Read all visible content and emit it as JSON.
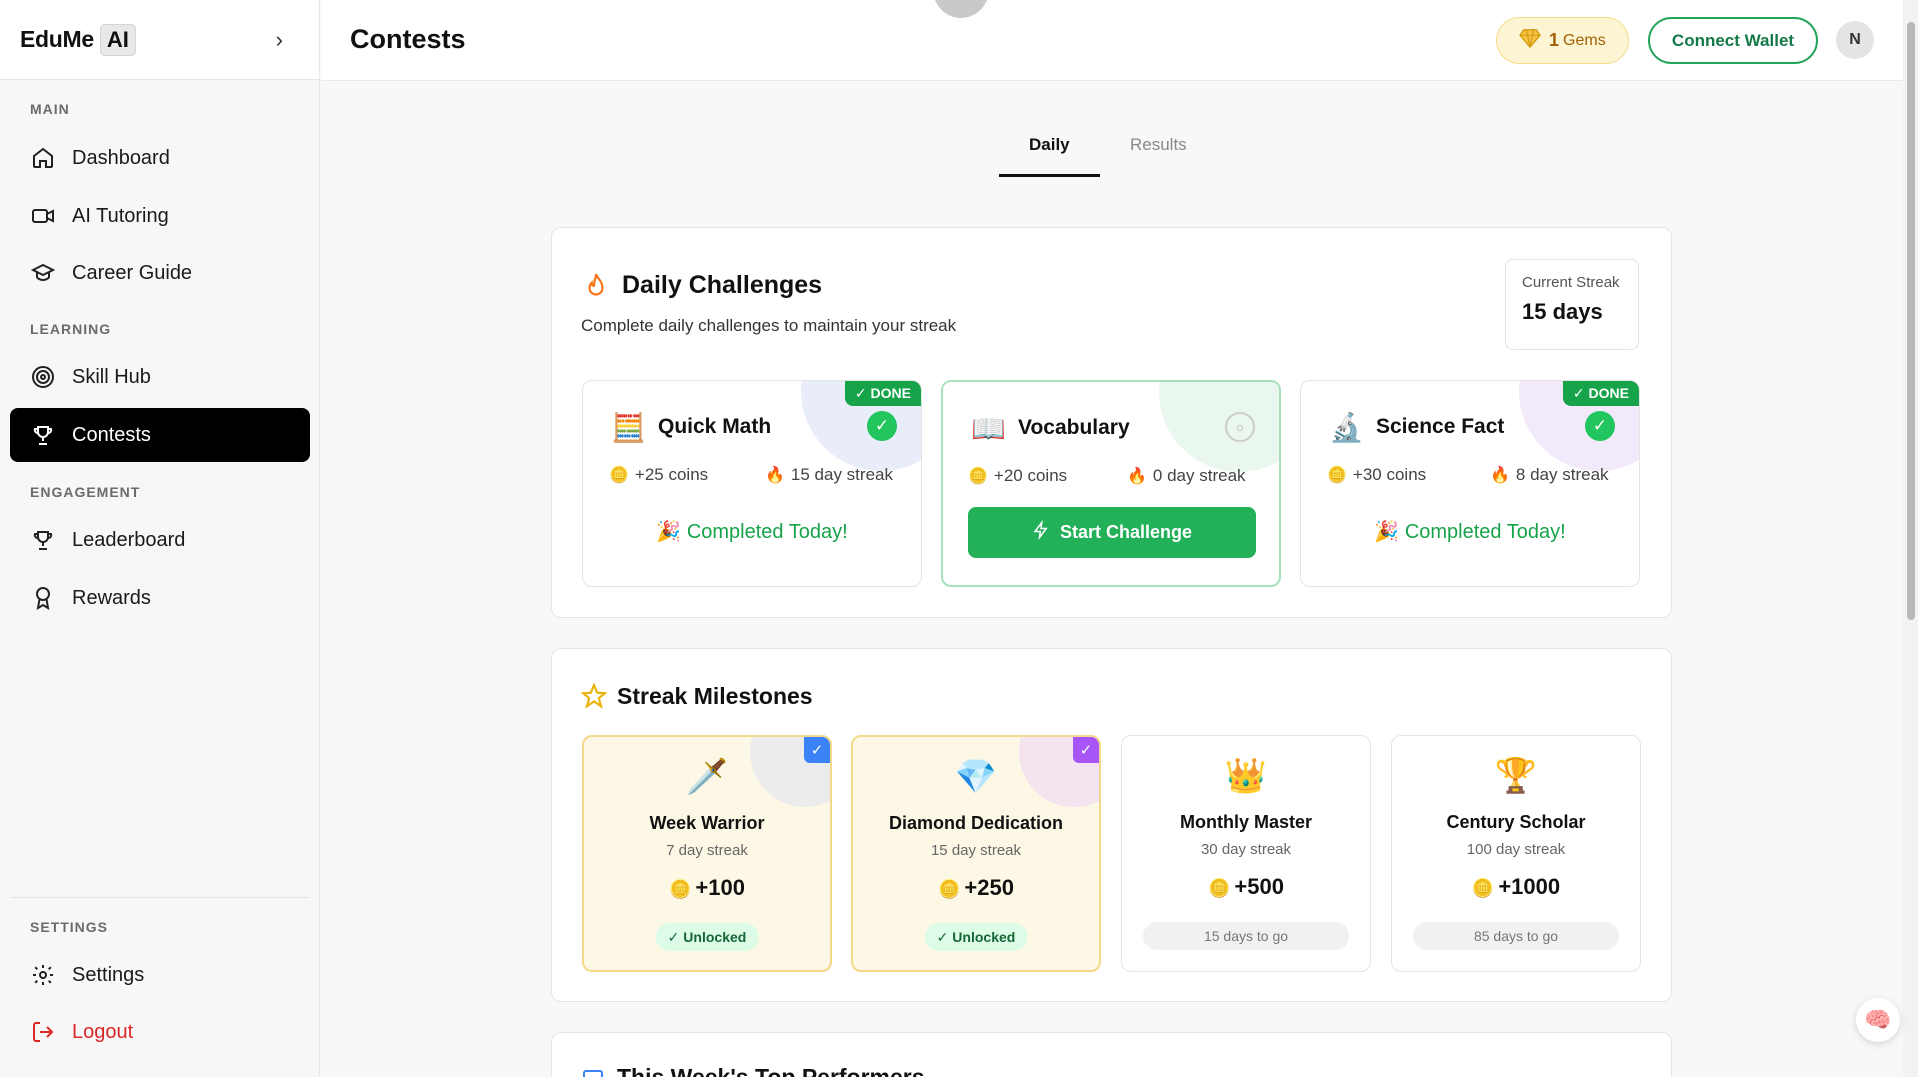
{
  "brand": {
    "name": "EduMe",
    "badge": "AI"
  },
  "sidebar": {
    "sections": {
      "main": "MAIN",
      "learning": "LEARNING",
      "engagement": "ENGAGEMENT",
      "settings": "SETTINGS"
    },
    "items": {
      "dashboard": "Dashboard",
      "ai_tutoring": "AI Tutoring",
      "career_guide": "Career Guide",
      "skill_hub": "Skill Hub",
      "contests": "Contests",
      "leaderboard": "Leaderboard",
      "rewards": "Rewards",
      "settings": "Settings",
      "logout": "Logout"
    },
    "active": "contests"
  },
  "header": {
    "title": "Contests",
    "gems_count": "1",
    "gems_label": "Gems",
    "wallet_label": "Connect Wallet",
    "avatar_initial": "N"
  },
  "tabs": [
    {
      "label": "Daily",
      "active": true
    },
    {
      "label": "Results",
      "active": false
    }
  ],
  "daily": {
    "title": "Daily Challenges",
    "subtitle": "Complete daily challenges to maintain your streak",
    "streak_label": "Current Streak",
    "streak_value": "15 days",
    "challenges": [
      {
        "title": "Quick Math",
        "emoji": "🧮",
        "coins": "+25 coins",
        "streak": "15 day streak",
        "status": "done",
        "badge": "✓ DONE",
        "footer": "Completed Today!"
      },
      {
        "title": "Vocabulary",
        "emoji": "📖",
        "coins": "+20 coins",
        "streak": "0 day streak",
        "status": "open",
        "button": "Start Challenge"
      },
      {
        "title": "Science Fact",
        "emoji": "🔬",
        "coins": "+30 coins",
        "streak": "8 day streak",
        "status": "done",
        "badge": "✓ DONE",
        "footer": "Completed Today!"
      }
    ]
  },
  "milestones": {
    "title": "Streak Milestones",
    "items": [
      {
        "name": "Week Warrior",
        "emoji": "🗡️",
        "days": "7 day streak",
        "reward": "+100",
        "status": "Unlocked",
        "unlocked": true
      },
      {
        "name": "Diamond Dedication",
        "emoji": "💎",
        "days": "15 day streak",
        "reward": "+250",
        "status": "Unlocked",
        "unlocked": true
      },
      {
        "name": "Monthly Master",
        "emoji": "👑",
        "days": "30 day streak",
        "reward": "+500",
        "status": "15 days to go",
        "unlocked": false
      },
      {
        "name": "Century Scholar",
        "emoji": "🏆",
        "days": "100 day streak",
        "reward": "+1000",
        "status": "85 days to go",
        "unlocked": false
      }
    ]
  },
  "next_section": {
    "title": "This Week's Top Performers"
  },
  "colors": {
    "accent_green": "#22b058",
    "active_nav": "#000000",
    "logout": "#dc2626",
    "gem": "#a16207"
  }
}
